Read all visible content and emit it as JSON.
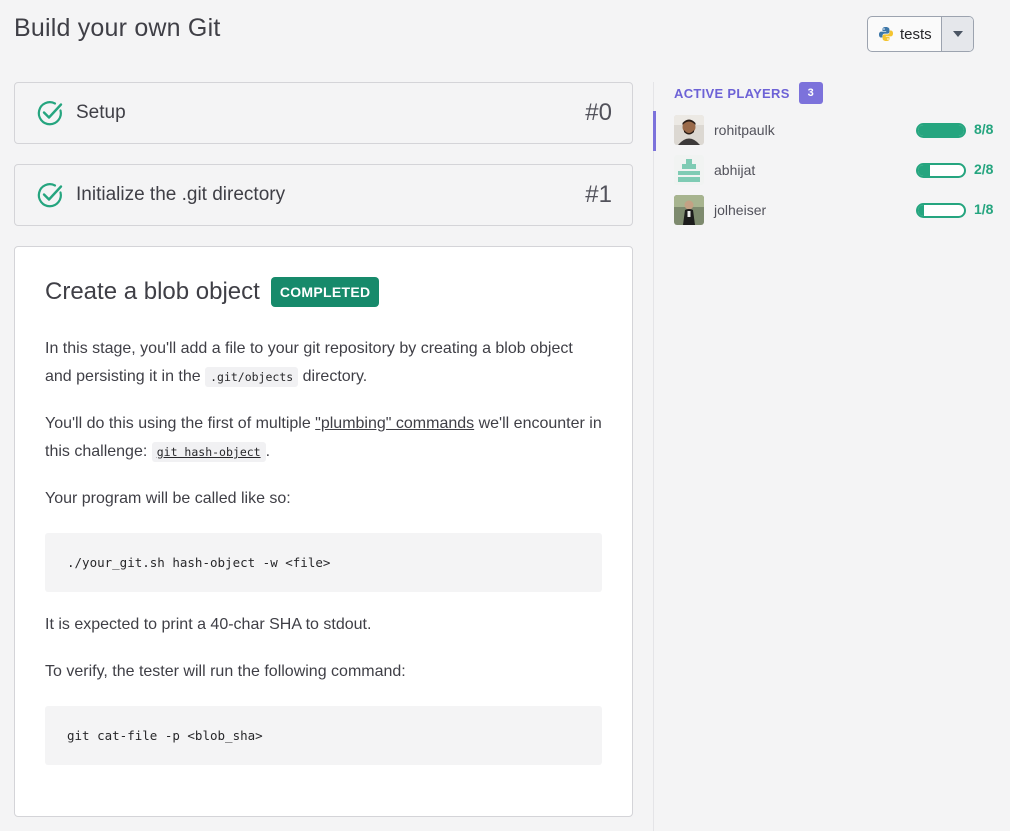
{
  "header": {
    "title": "Build your own Git",
    "language_label": "tests",
    "language_icon": "python-logo-icon"
  },
  "stages": [
    {
      "label": "Setup",
      "number": "#0",
      "status_icon": "check-circle-icon"
    },
    {
      "label": "Initialize the .git directory",
      "number": "#1",
      "status_icon": "check-circle-icon"
    }
  ],
  "current_stage": {
    "title": "Create a blob object",
    "badge": "COMPLETED",
    "p1_before": "In this stage, you'll add a file to your git repository by creating a blob object and persisting it in the ",
    "p1_code": ".git/objects",
    "p1_after": " directory.",
    "p2_before": "You'll do this using the first of multiple ",
    "p2_link": "\"plumbing\" commands",
    "p2_middle": " we'll encounter in this challenge: ",
    "p2_code": "git hash-object",
    "p2_after": ".",
    "p3": "Your program will be called like so:",
    "code1": "./your_git.sh hash-object -w <file>",
    "p4": "It is expected to print a 40-char SHA to stdout.",
    "p5": "To verify, the tester will run the following command:",
    "code2": "git cat-file -p <blob_sha>"
  },
  "players": {
    "label": "ACTIVE PLAYERS",
    "count": "3",
    "list": [
      {
        "name": "rohitpaulk",
        "progress_text": "8/8",
        "progress": 1.0
      },
      {
        "name": "abhijat",
        "progress_text": "2/8",
        "progress": 0.25
      },
      {
        "name": "jolheiser",
        "progress_text": "1/8",
        "progress": 0.125
      }
    ]
  },
  "colors": {
    "accent_green": "#25a57f",
    "badge_green": "#178a6b",
    "accent_purple": "#7c72db"
  }
}
